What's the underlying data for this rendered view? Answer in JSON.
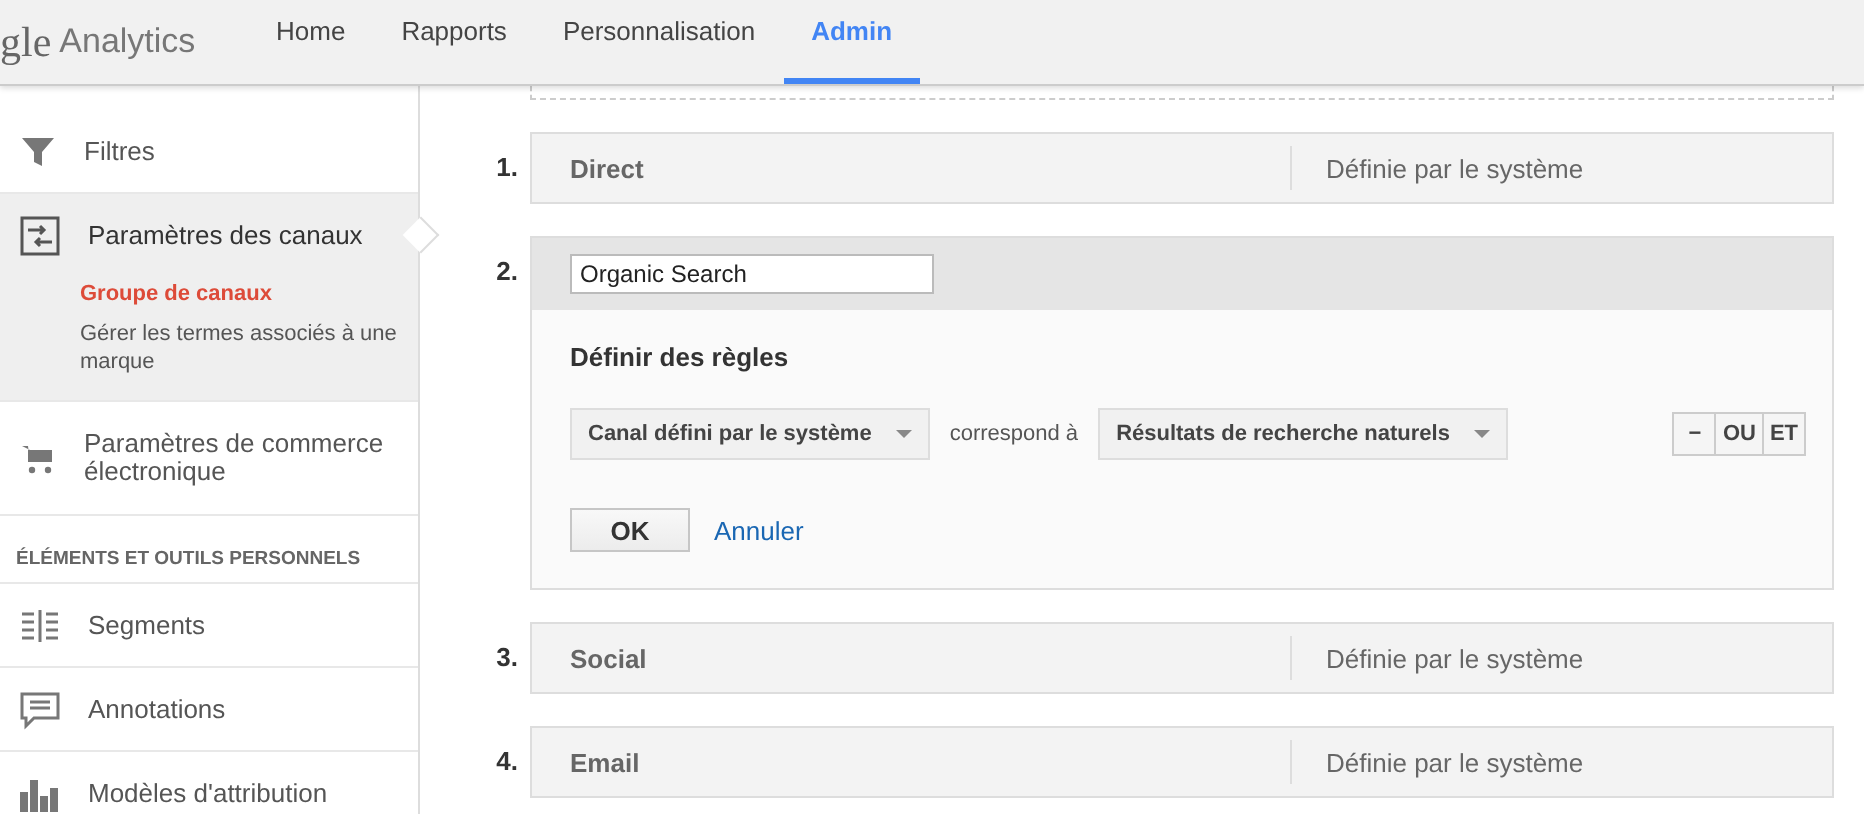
{
  "header": {
    "logo_text": "gle",
    "product": "Analytics"
  },
  "nav_tabs": [
    {
      "label": "Home",
      "selected": false
    },
    {
      "label": "Rapports",
      "selected": false
    },
    {
      "label": "Personnalisation",
      "selected": false
    },
    {
      "label": "Admin",
      "selected": true
    }
  ],
  "sidebar": {
    "items": [
      {
        "kind": "item",
        "label": "Filtres",
        "selected": false
      },
      {
        "kind": "item",
        "label": "Paramètres des canaux",
        "selected": true,
        "children": [
          {
            "label": "Groupe de canaux",
            "selected": true
          },
          {
            "label": "Gérer les termes associés à une marque",
            "selected": false
          }
        ]
      },
      {
        "kind": "item",
        "label": "Paramètres de commerce électronique",
        "selected": false
      },
      {
        "kind": "section",
        "label": "ÉLÉMENTS ET OUTILS PERSONNELS"
      },
      {
        "kind": "item",
        "label": "Segments",
        "selected": false
      },
      {
        "kind": "item",
        "label": "Annotations",
        "selected": false
      },
      {
        "kind": "item",
        "label": "Modèles d'attribution",
        "selected": false
      }
    ]
  },
  "channels": [
    {
      "kind": "collapsed",
      "number": "1.",
      "name": "Direct",
      "definition": "Définie par le système"
    },
    {
      "kind": "expanded",
      "number": "2.",
      "name": "Organic Search",
      "rules_title": "Définir des règles",
      "rule": {
        "dimension": "Canal défini par le système",
        "operator": "correspond à",
        "value": "Résultats de recherche naturels"
      },
      "rule_buttons": [
        "−",
        "OU",
        "ET"
      ],
      "ok": "OK",
      "cancel": "Annuler"
    },
    {
      "kind": "collapsed",
      "number": "3.",
      "name": "Social",
      "definition": "Définie par le système"
    },
    {
      "kind": "collapsed",
      "number": "4.",
      "name": "Email",
      "definition": "Définie par le système"
    }
  ]
}
